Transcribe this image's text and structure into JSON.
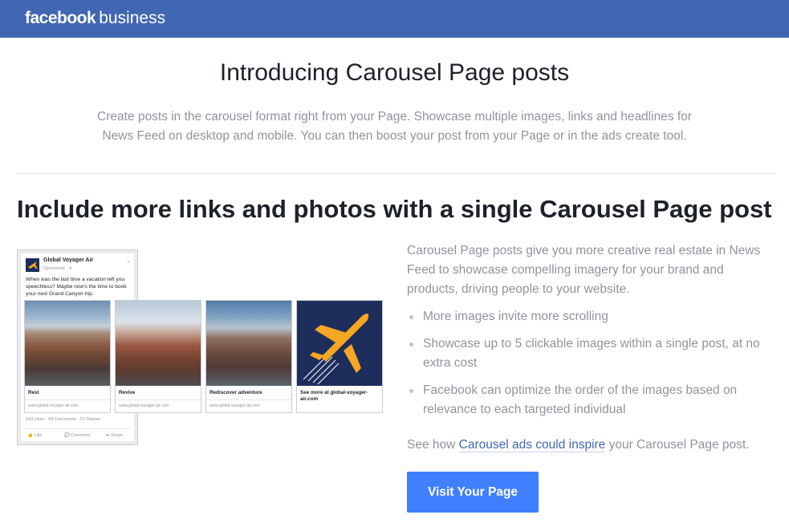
{
  "header": {
    "brand_bold": "facebook",
    "brand_light": "business"
  },
  "intro": {
    "title": "Introducing Carousel Page posts",
    "description": "Create posts in the carousel format right from your Page. Showcase multiple images, links and headlines for News Feed on desktop and mobile. You can then boost your post from your Page or in the ads create tool."
  },
  "section": {
    "title": "Include more links and photos with a single Carousel Page post",
    "body": "Carousel Page posts give you more creative real estate in News Feed to showcase compelling imagery for your brand and products, driving people to your website.",
    "bullets": [
      "More images invite more scrolling",
      "Showcase up to 5 clickable images within a single post, at no extra cost",
      "Facebook can optimize the order of the images based on relevance to each targeted individual"
    ],
    "see_how_prefix": "See how ",
    "see_how_link": "Carousel ads could inspire",
    "see_how_suffix": " your Carousel Page post.",
    "cta_label": "Visit Your Page"
  },
  "illustration": {
    "page_name": "Global Voyager Air",
    "sponsored": "Sponsored · ✈",
    "post_text": "When was the last time a vacation left you speechless? Maybe now's the time to book your next Grand Canyon trip.",
    "stats": "143 Likes · 64 Comments · 22 Shares",
    "actions": [
      "Like",
      "Comment",
      "Share"
    ],
    "cards": [
      {
        "caption": "Rest",
        "url": "www.global-voyager-air.com"
      },
      {
        "caption": "Revive",
        "url": "www.global-voyager-air.com"
      },
      {
        "caption": "Rediscover adventure",
        "url": "www.global-voyager-air.com"
      },
      {
        "caption": "See more at global-voyager-air.com",
        "url": ""
      }
    ]
  },
  "colors": {
    "topbar": "#4267b2",
    "cta": "#4080ff",
    "link": "#4267b2"
  }
}
